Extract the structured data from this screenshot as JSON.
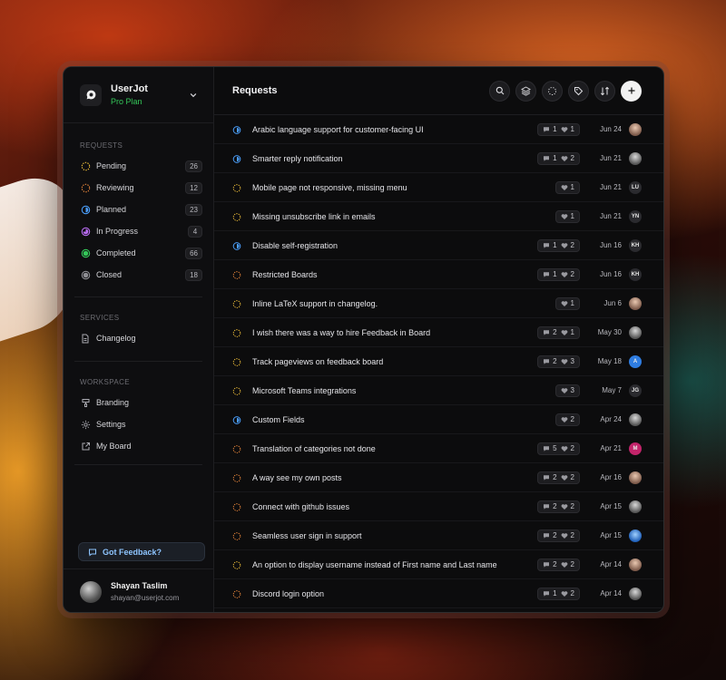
{
  "app": {
    "name": "UserJot",
    "plan": "Pro Plan"
  },
  "sidebar": {
    "requests_title": "REQUESTS",
    "requests": [
      {
        "label": "Pending",
        "count": "26",
        "icon": "dotted-circle-icon",
        "color": "#f5c33b"
      },
      {
        "label": "Reviewing",
        "count": "12",
        "icon": "dotted-circle-icon",
        "color": "#f08a3c"
      },
      {
        "label": "Planned",
        "count": "23",
        "icon": "half-circle-icon",
        "color": "#4a9df8"
      },
      {
        "label": "In Progress",
        "count": "4",
        "icon": "three-quarter-circle-icon",
        "color": "#b86cf0"
      },
      {
        "label": "Completed",
        "count": "66",
        "icon": "filled-circle-icon",
        "color": "#34c759"
      },
      {
        "label": "Closed",
        "count": "18",
        "icon": "filled-circle-icon",
        "color": "#8e8e93"
      }
    ],
    "services_title": "SERVICES",
    "services": [
      {
        "label": "Changelog",
        "icon": "document-icon"
      }
    ],
    "workspace_title": "WORKSPACE",
    "workspace": [
      {
        "label": "Branding",
        "icon": "brush-icon"
      },
      {
        "label": "Settings",
        "icon": "gear-icon"
      },
      {
        "label": "My Board",
        "icon": "external-link-icon"
      }
    ],
    "feedback_label": "Got Feedback?"
  },
  "user": {
    "name": "Shayan Taslim",
    "email": "shayan@userjot.com"
  },
  "main": {
    "title": "Requests",
    "toolbar": [
      "search-icon",
      "layers-icon",
      "loader-icon",
      "tag-icon",
      "sort-icon",
      "plus-icon"
    ]
  },
  "requests": [
    {
      "title": "Arabic language support for customer-facing UI",
      "status": "planned",
      "comments": "1",
      "votes": "1",
      "date": "Jun 24",
      "avatar": "photo"
    },
    {
      "title": "Smarter reply notification",
      "status": "planned",
      "comments": "1",
      "votes": "2",
      "date": "Jun 21",
      "avatar": "photo"
    },
    {
      "title": "Mobile page not responsive, missing menu",
      "status": "pending",
      "comments": "",
      "votes": "1",
      "date": "Jun 21",
      "avatar": "LU"
    },
    {
      "title": "Missing unsubscribe link in emails",
      "status": "pending",
      "comments": "",
      "votes": "1",
      "date": "Jun 21",
      "avatar": "YN"
    },
    {
      "title": "Disable self-registration",
      "status": "planned",
      "comments": "1",
      "votes": "2",
      "date": "Jun 16",
      "avatar": "KH"
    },
    {
      "title": "Restricted Boards",
      "status": "reviewing",
      "comments": "1",
      "votes": "2",
      "date": "Jun 16",
      "avatar": "KH"
    },
    {
      "title": "Inline LaTeX support in changelog.",
      "status": "pending",
      "comments": "",
      "votes": "1",
      "date": "Jun 6",
      "avatar": "photo"
    },
    {
      "title": "I wish there was a way to hire Feedback in Board",
      "status": "pending",
      "comments": "2",
      "votes": "1",
      "date": "May 30",
      "avatar": "photo"
    },
    {
      "title": "Track pageviews on feedback board",
      "status": "pending",
      "comments": "2",
      "votes": "3",
      "date": "May 18",
      "avatar": "A"
    },
    {
      "title": "Microsoft Teams integrations",
      "status": "pending",
      "comments": "",
      "votes": "3",
      "date": "May 7",
      "avatar": "JG"
    },
    {
      "title": "Custom Fields",
      "status": "planned",
      "comments": "",
      "votes": "2",
      "date": "Apr 24",
      "avatar": "photo"
    },
    {
      "title": "Translation of categories not done",
      "status": "reviewing",
      "comments": "5",
      "votes": "2",
      "date": "Apr 21",
      "avatar": "M"
    },
    {
      "title": "A way see my own posts",
      "status": "reviewing",
      "comments": "2",
      "votes": "2",
      "date": "Apr 16",
      "avatar": "photo"
    },
    {
      "title": "Connect with github issues",
      "status": "reviewing",
      "comments": "2",
      "votes": "2",
      "date": "Apr 15",
      "avatar": "photo"
    },
    {
      "title": "Seamless user sign in support",
      "status": "reviewing",
      "comments": "2",
      "votes": "2",
      "date": "Apr 15",
      "avatar": "photo"
    },
    {
      "title": "An option to display username instead of First name and Last name",
      "status": "pending",
      "comments": "2",
      "votes": "2",
      "date": "Apr 14",
      "avatar": "photo"
    },
    {
      "title": "Discord login option",
      "status": "reviewing",
      "comments": "1",
      "votes": "2",
      "date": "Apr 14",
      "avatar": "photo"
    }
  ],
  "colors": {
    "pending": "#f5c33b",
    "reviewing": "#f08a3c",
    "planned": "#4a9df8",
    "accent_green": "#34c759",
    "link_blue": "#8ec5ff"
  }
}
